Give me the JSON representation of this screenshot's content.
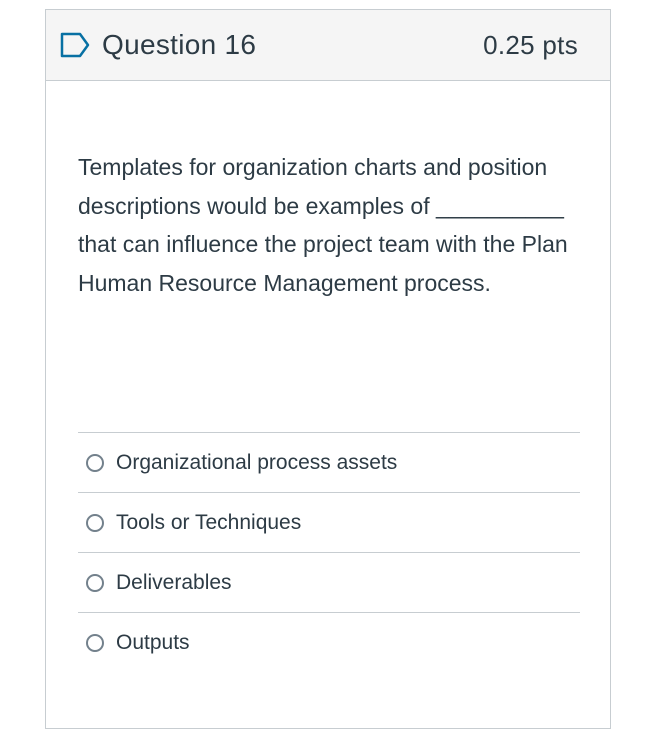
{
  "question": {
    "title": "Question 16",
    "points": "0.25 pts",
    "flag_icon": "bookmark-flag-icon",
    "text": "Templates for organization charts and position descriptions would be examples of __________ that can influence the project team with the Plan Human Resource Management process."
  },
  "answers": [
    {
      "label": "Organizational process assets"
    },
    {
      "label": "Tools or Techniques"
    },
    {
      "label": "Deliverables"
    },
    {
      "label": "Outputs"
    }
  ],
  "colors": {
    "text": "#2d3b45",
    "header_bg": "#f5f5f5",
    "border": "#c7cdd1",
    "flag": "#0770a3"
  }
}
